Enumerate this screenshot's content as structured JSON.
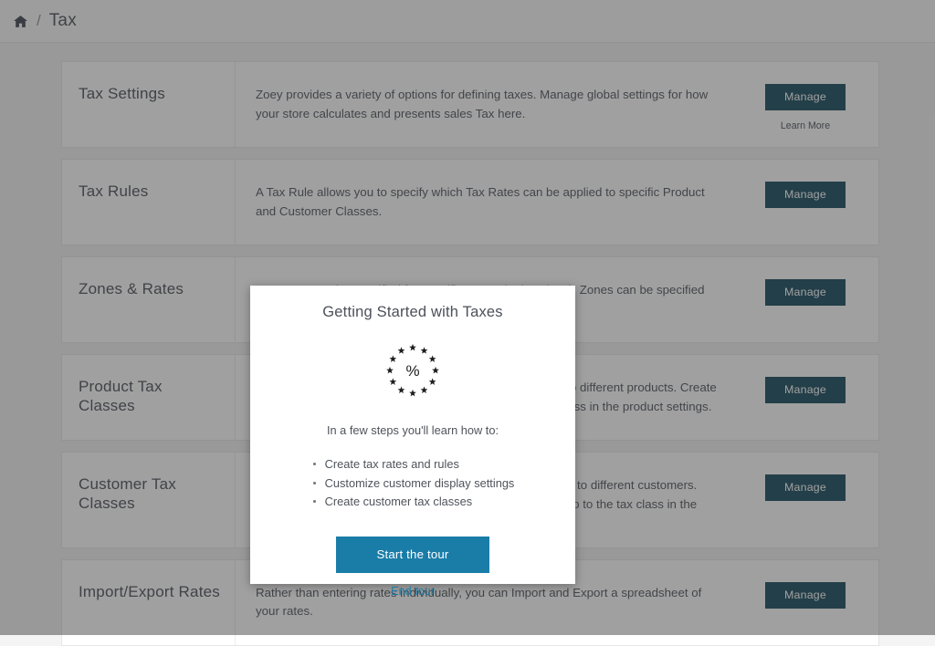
{
  "breadcrumb": {
    "home_icon": "home-icon",
    "separator": "/",
    "current": "Tax"
  },
  "rows": [
    {
      "title": "Tax Settings",
      "description": "Zoey provides a variety of options for defining taxes. Manage global settings for how your store calculates and presents sales Tax here.",
      "button": "Manage",
      "link": "Learn More"
    },
    {
      "title": "Tax Rules",
      "description": "A Tax Rule allows you to specify which Tax Rates can be applied to specific Product and Customer Classes.",
      "button": "Manage",
      "link": ""
    },
    {
      "title": "Zones & Rates",
      "description": "Tax Rates can be specified for specific Zones (or locations). Zones can be specified by Country, State or Zip/Postal code.",
      "button": "Manage",
      "link": ""
    },
    {
      "title": "Product Tax Classes",
      "description": "Product Tax Classes allow you to apply different tax rates to different products. Create the Tax Class here, then assign your products to the tax class in the product settings.",
      "button": "Manage",
      "link": ""
    },
    {
      "title": "Customer Tax Classes",
      "description": "Customer Tax Classes allow you to apply different tax rates to different customers. Create the Tax Class here, then assign your customer group to the tax class in the customer group settings.",
      "button": "Manage",
      "link": ""
    },
    {
      "title": "Import/Export Rates",
      "description": "Rather than entering rates individually, you can Import and Export a spreadsheet of your rates.",
      "button": "Manage",
      "link": ""
    }
  ],
  "modal": {
    "title": "Getting Started with Taxes",
    "emblem_icon": "tax-percent-stars-icon",
    "emblem_symbol": "%",
    "intro": "In a few steps you'll learn how to:",
    "benefits": [
      "Create tax rates and rules",
      "Customize customer display settings",
      "Create customer tax classes"
    ],
    "primary_button": "Start the tour",
    "secondary_link": "End tour"
  },
  "colors": {
    "manage_button": "#14485c",
    "start_tour_button": "#1a7da8",
    "link": "#1a7da8",
    "overlay": "rgba(54,54,54,0.47)"
  }
}
